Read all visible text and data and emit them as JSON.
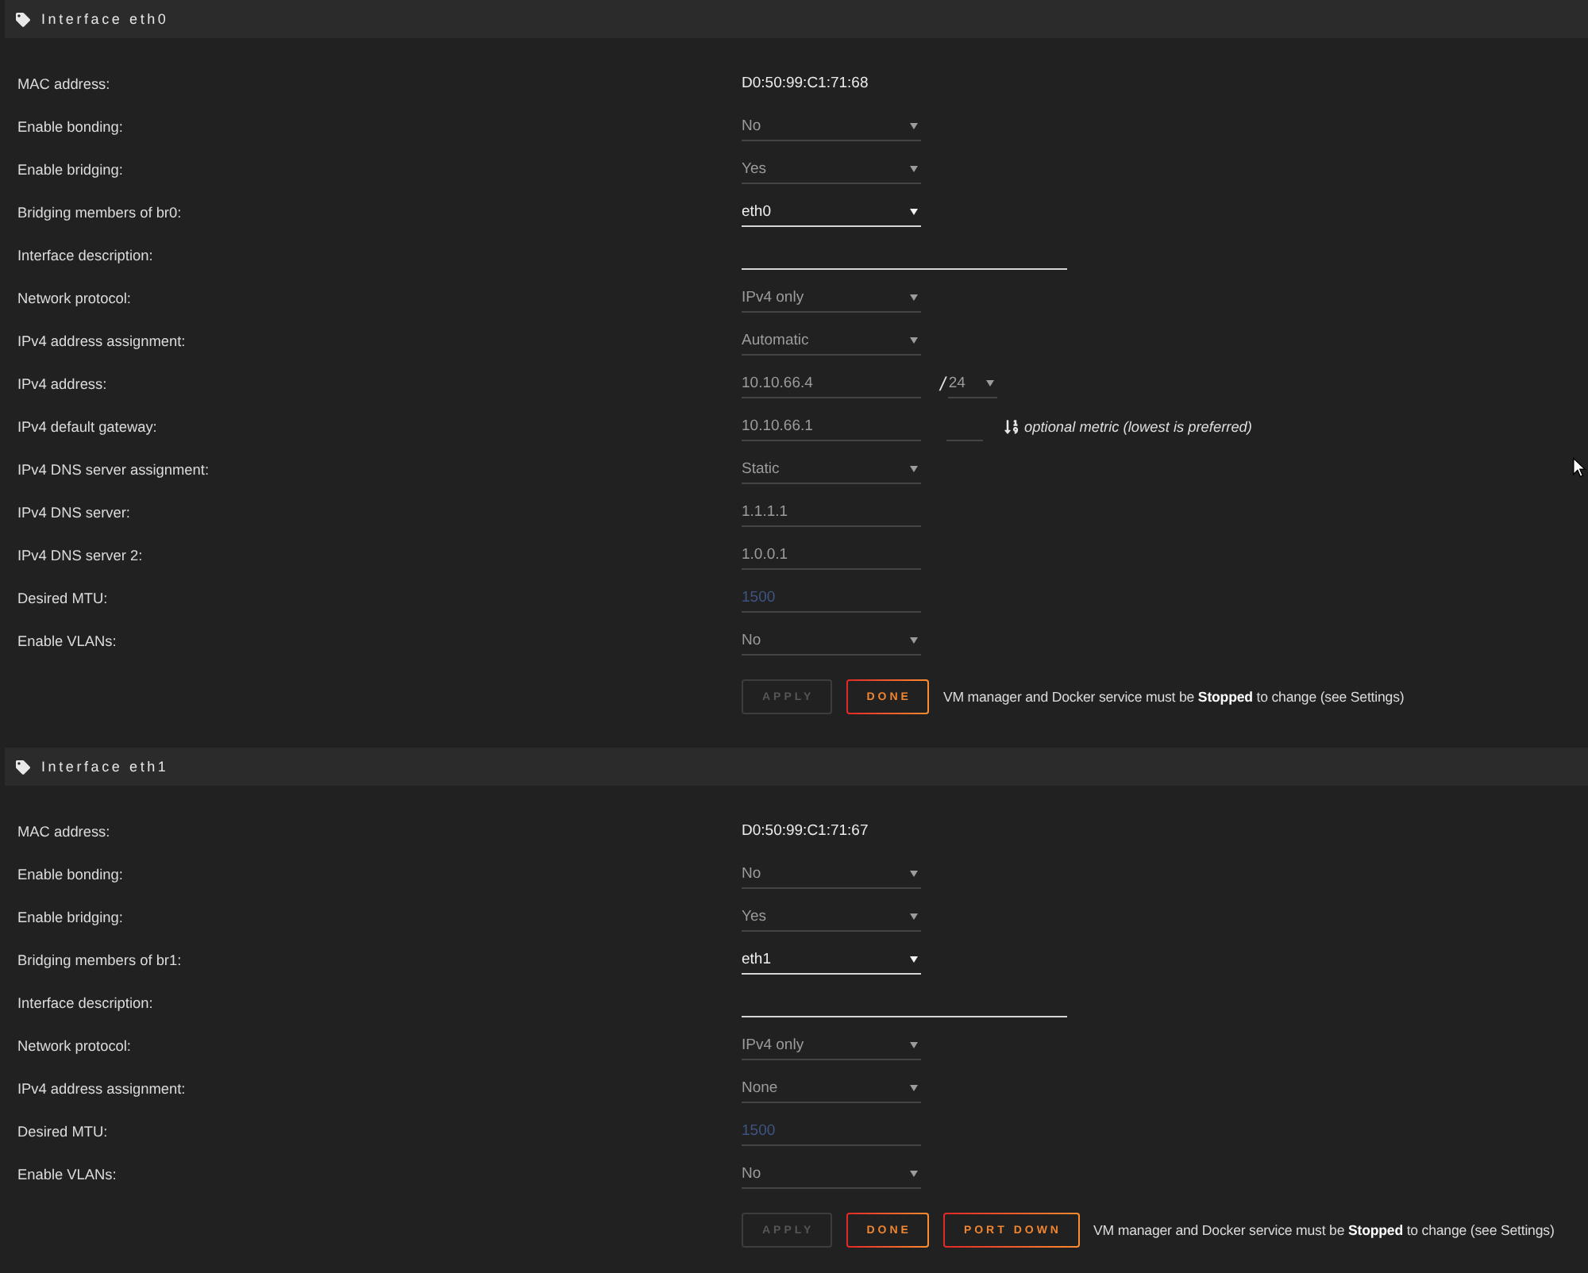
{
  "sections": [
    {
      "title": "Interface eth0",
      "rows": [
        {
          "label": "MAC address:",
          "kind": "text",
          "value": "D0:50:99:C1:71:68"
        },
        {
          "label": "Enable bonding:",
          "kind": "select",
          "value": "No",
          "disabled": true
        },
        {
          "label": "Enable bridging:",
          "kind": "select",
          "value": "Yes",
          "disabled": true
        },
        {
          "label": "Bridging members of br0:",
          "kind": "select",
          "value": "eth0",
          "disabled": false
        },
        {
          "label": "Interface description:",
          "kind": "input",
          "disabled": false
        },
        {
          "label": "Network protocol:",
          "kind": "select",
          "value": "IPv4 only",
          "disabled": true
        },
        {
          "label": "IPv4 address assignment:",
          "kind": "select",
          "value": "Automatic",
          "disabled": true
        },
        {
          "label": "IPv4 address:",
          "kind": "address",
          "value": "10.10.66.4",
          "disabled": true,
          "separator": "/",
          "prefix": {
            "value": "24",
            "disabled": true
          }
        },
        {
          "label": "IPv4 default gateway:",
          "kind": "gateway",
          "value": "10.10.66.1",
          "disabled": true,
          "metric": {
            "disabled": true
          },
          "hint": "optional metric (lowest is preferred)"
        },
        {
          "label": "IPv4 DNS server assignment:",
          "kind": "select",
          "value": "Static",
          "disabled": true
        },
        {
          "label": "IPv4 DNS server:",
          "kind": "input",
          "value": "1.1.1.1",
          "disabled": true
        },
        {
          "label": "IPv4 DNS server 2:",
          "kind": "input",
          "value": "1.0.0.1",
          "disabled": true
        },
        {
          "label": "Desired MTU:",
          "kind": "input",
          "placeholder": "1500",
          "disabled": true
        },
        {
          "label": "Enable VLANs:",
          "kind": "select",
          "value": "No",
          "disabled": true
        }
      ],
      "buttons": [
        {
          "label": "APPLY",
          "disabled": true
        },
        {
          "label": "DONE",
          "disabled": false
        }
      ],
      "note": "VM manager and Docker service must be **Stopped** to change (see Settings)"
    },
    {
      "title": "Interface eth1",
      "rows": [
        {
          "label": "MAC address:",
          "kind": "text",
          "value": "D0:50:99:C1:71:67"
        },
        {
          "label": "Enable bonding:",
          "kind": "select",
          "value": "No",
          "disabled": true
        },
        {
          "label": "Enable bridging:",
          "kind": "select",
          "value": "Yes",
          "disabled": true
        },
        {
          "label": "Bridging members of br1:",
          "kind": "select",
          "value": "eth1",
          "disabled": false
        },
        {
          "label": "Interface description:",
          "kind": "input",
          "disabled": false
        },
        {
          "label": "Network protocol:",
          "kind": "select",
          "value": "IPv4 only",
          "disabled": true
        },
        {
          "label": "IPv4 address assignment:",
          "kind": "select",
          "value": "None",
          "disabled": true
        },
        {
          "label": "Desired MTU:",
          "kind": "input",
          "placeholder": "1500",
          "disabled": true
        },
        {
          "label": "Enable VLANs:",
          "kind": "select",
          "value": "No",
          "disabled": true
        }
      ],
      "buttons": [
        {
          "label": "APPLY",
          "disabled": true
        },
        {
          "label": "DONE",
          "disabled": false
        },
        {
          "label": "PORT DOWN",
          "disabled": false
        }
      ],
      "note": "VM manager and Docker service must be **Stopped** to change (see Settings)"
    }
  ]
}
